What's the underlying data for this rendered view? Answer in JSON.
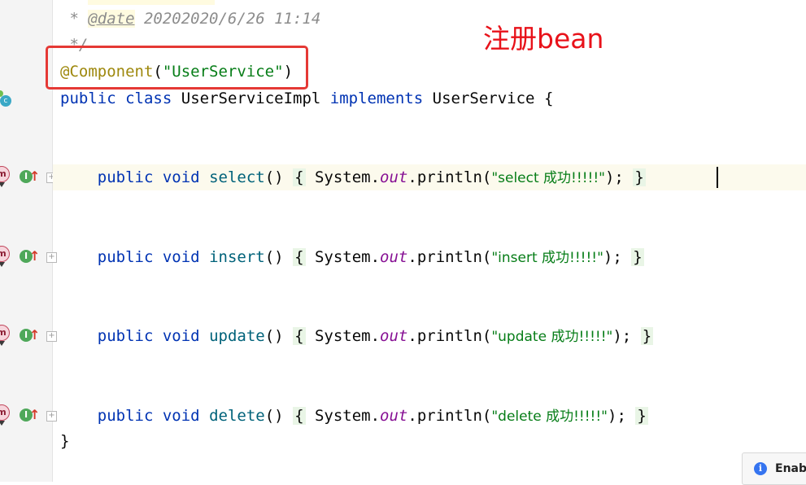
{
  "editor": {
    "doc_comment": {
      "prefix": " * ",
      "tag": "@date",
      "text": " 20202020/6/26 11:14",
      "end": " */"
    },
    "annotation": {
      "name": "@Component",
      "open": "(",
      "arg": "\"UserService\"",
      "close": ")"
    },
    "class_decl": {
      "kw_public": "public",
      "kw_class": "class",
      "name": "UserServiceImpl",
      "kw_implements": "implements",
      "iface": "UserService",
      "brace": "{"
    },
    "methods": [
      {
        "name": "select",
        "message": "\"select 成功!!!!!\""
      },
      {
        "name": "insert",
        "message": "\"insert 成功!!!!!\""
      },
      {
        "name": "update",
        "message": "\"update 成功!!!!!\""
      },
      {
        "name": "delete",
        "message": "\"delete 成功!!!!!\""
      }
    ],
    "method_tokens": {
      "kw_public": "public",
      "kw_void": "void",
      "parens": "()",
      "open_brace": "{",
      "system": "System.",
      "out": "out",
      "println": ".println(",
      "close_call": ");",
      "close_brace": "}"
    },
    "class_close": "}"
  },
  "gutter": {
    "class_marker": "c",
    "method_marker": "m",
    "implements_marker": "I",
    "override_arrow": "↑",
    "fold_plus": "+"
  },
  "annotation_note": "注册bean",
  "notification": {
    "icon": "i",
    "text": "Enab"
  }
}
